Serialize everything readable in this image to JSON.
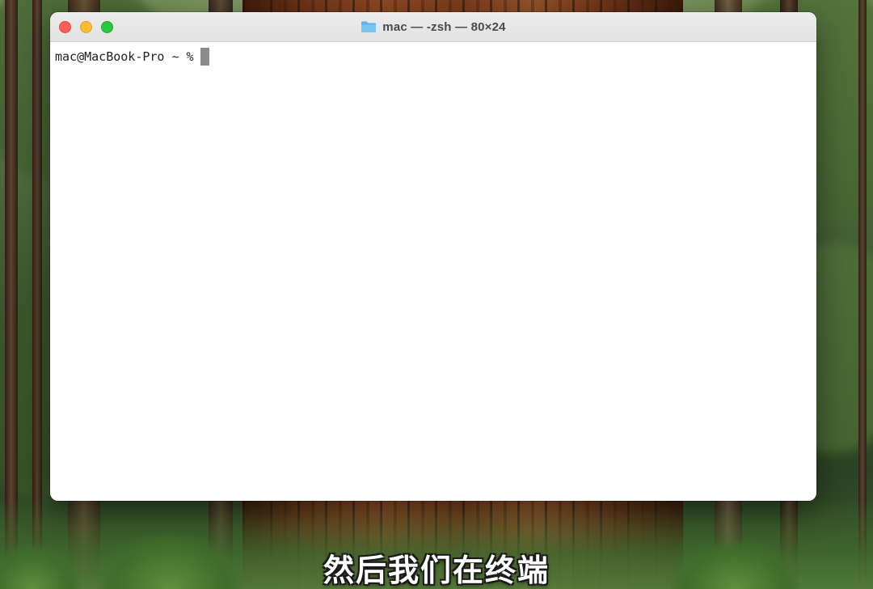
{
  "window": {
    "title": "mac — -zsh — 80×24",
    "title_icon": "folder-icon"
  },
  "terminal": {
    "prompt": "mac@MacBook-Pro ~ %",
    "background_color": "#ffffff",
    "text_color": "#1f1f1f",
    "cursor_color": "#8c8c8c"
  },
  "traffic_lights": {
    "close_color": "#fe5f57",
    "minimize_color": "#febc2e",
    "zoom_color": "#28c840"
  },
  "caption": {
    "text": "然后我们在终端"
  }
}
